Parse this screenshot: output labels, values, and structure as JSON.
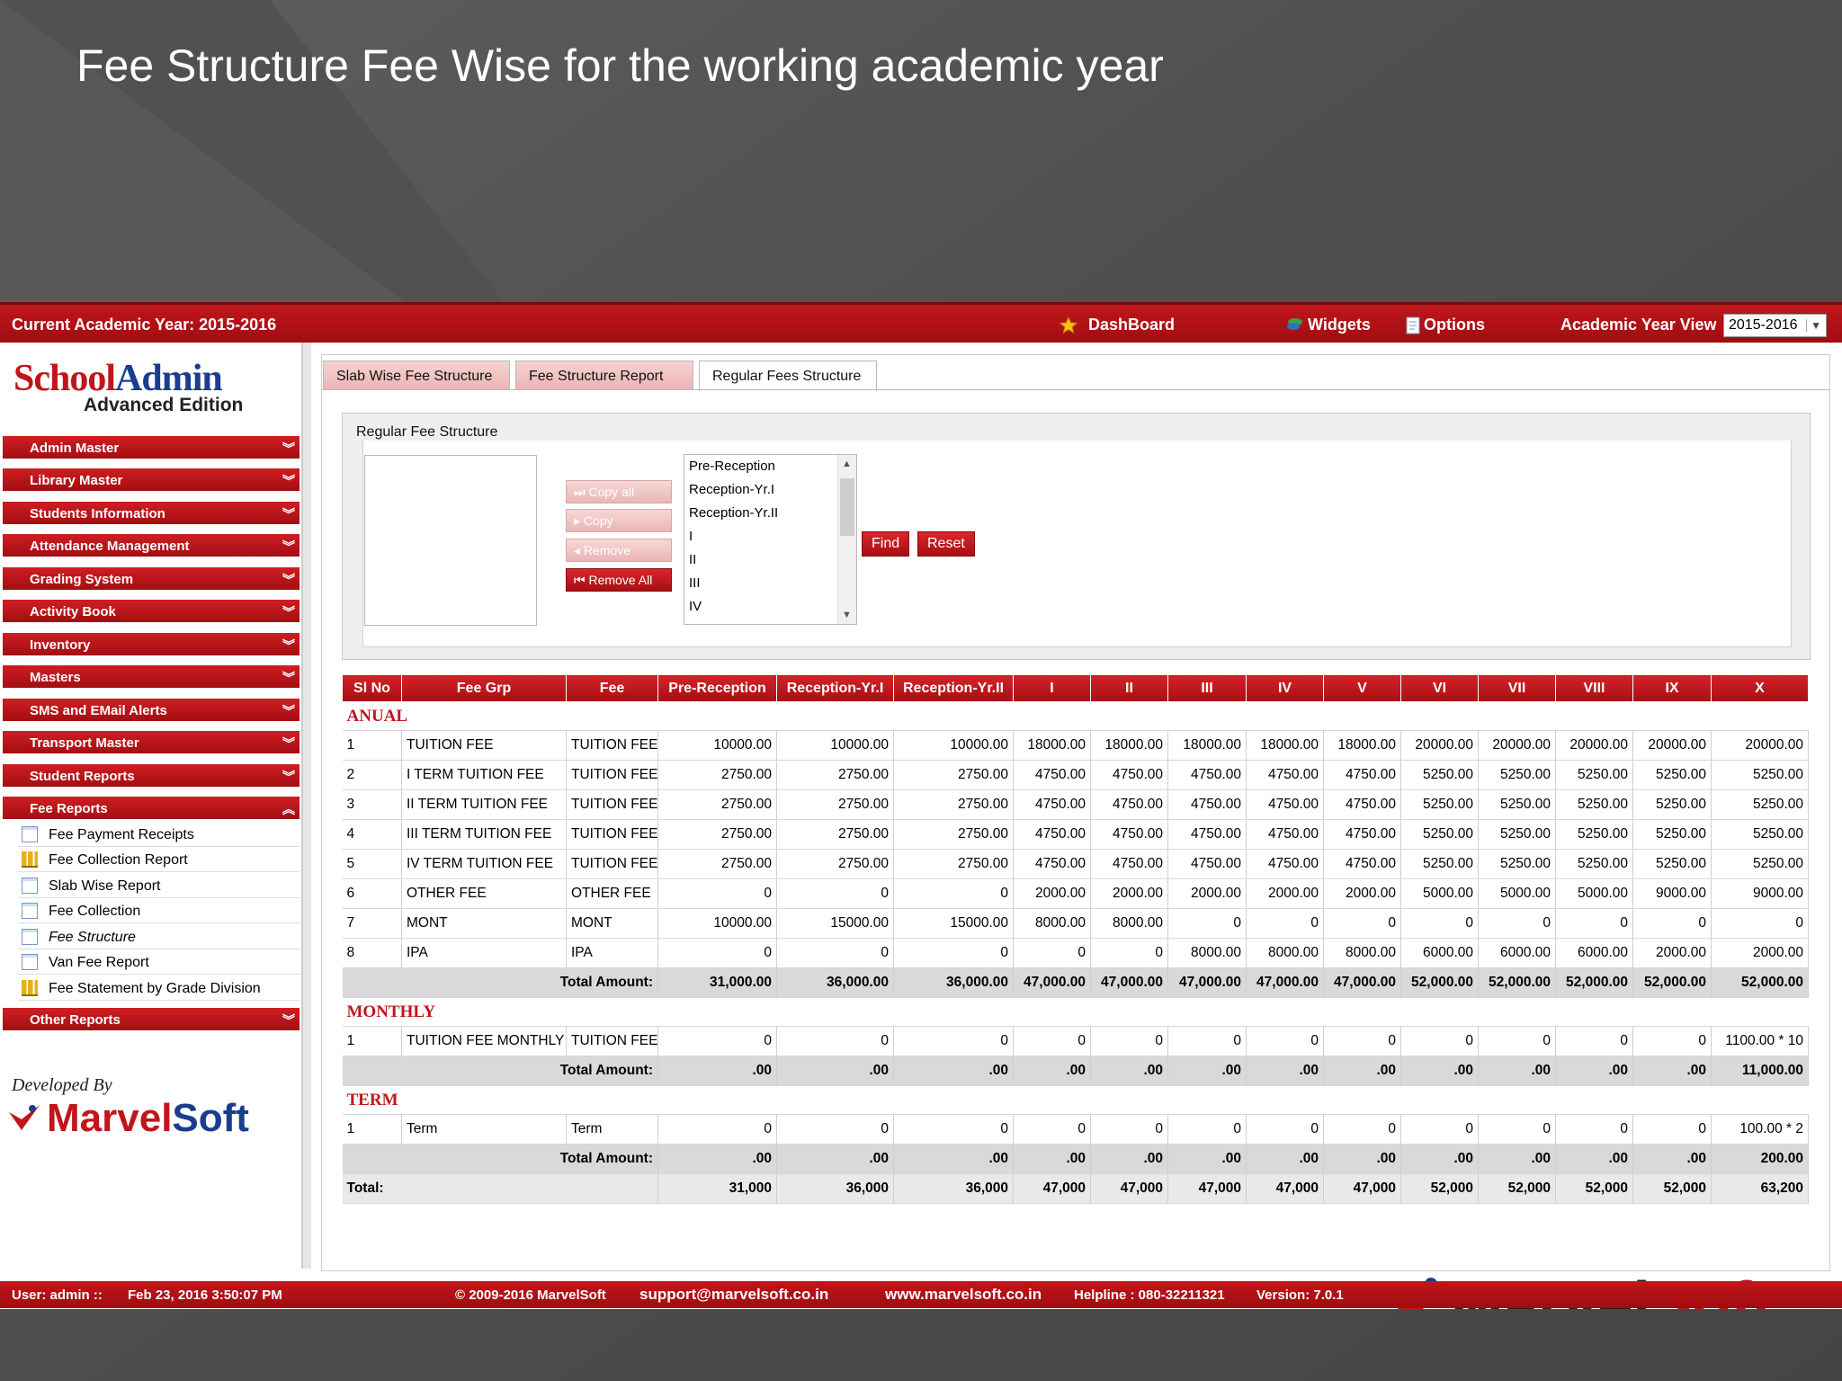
{
  "slide": {
    "title": "Fee Structure Fee Wise for the working academic year"
  },
  "topbar": {
    "academic_year": "Current Academic Year: 2015-2016",
    "dashboard": "DashBoard",
    "widgets": "Widgets",
    "options": "Options",
    "academic_year_view": "Academic Year View",
    "year_select": "2015-2016"
  },
  "logo": {
    "part1": "School",
    "part2": "Admin",
    "edition": "Advanced Edition"
  },
  "sidebar": {
    "menus": [
      "Admin Master",
      "Library Master",
      "Students Information",
      "Attendance Management",
      "Grading System",
      "Activity Book",
      "Inventory",
      "Masters",
      "SMS and EMail Alerts",
      "Transport Master",
      "Student Reports",
      "Fee Reports"
    ],
    "fee_reports_items": [
      "Fee Payment Receipts",
      "Fee Collection Report",
      "Slab Wise Report",
      "Fee Collection",
      "Fee Structure",
      "Van Fee Report",
      "Fee Statement by Grade Division"
    ],
    "other_reports": "Other Reports",
    "developed_by": "Developed By",
    "brand1": "Marvel",
    "brand2": "Soft"
  },
  "tabs": [
    "Slab Wise Fee Structure",
    "Fee Structure Report",
    "Regular Fees Structure"
  ],
  "form": {
    "legend": "Regular Fee Structure",
    "btn_copy_all": "Copy all",
    "btn_copy": "Copy",
    "btn_remove": "Remove",
    "btn_remove_all": "Remove All",
    "class_options": [
      "Pre-Reception",
      "Reception-Yr.I",
      "Reception-Yr.II",
      "I",
      "II",
      "III",
      "IV"
    ],
    "find": "Find",
    "reset": "Reset"
  },
  "grid": {
    "headers": [
      "Sl No",
      "Fee Grp",
      "Fee",
      "Pre-Reception",
      "Reception-Yr.I",
      "Reception-Yr.II",
      "I",
      "II",
      "III",
      "IV",
      "V",
      "VI",
      "VII",
      "VIII",
      "IX",
      "X"
    ],
    "groups": [
      {
        "name": "ANUAL",
        "rows": [
          [
            "1",
            "TUITION FEE",
            "TUITION FEE",
            "10000.00",
            "10000.00",
            "10000.00",
            "18000.00",
            "18000.00",
            "18000.00",
            "18000.00",
            "18000.00",
            "20000.00",
            "20000.00",
            "20000.00",
            "20000.00",
            "20000.00"
          ],
          [
            "2",
            "I TERM TUITION FEE",
            "TUITION FEE",
            "2750.00",
            "2750.00",
            "2750.00",
            "4750.00",
            "4750.00",
            "4750.00",
            "4750.00",
            "4750.00",
            "5250.00",
            "5250.00",
            "5250.00",
            "5250.00",
            "5250.00"
          ],
          [
            "3",
            "II TERM TUITION FEE",
            "TUITION FEE",
            "2750.00",
            "2750.00",
            "2750.00",
            "4750.00",
            "4750.00",
            "4750.00",
            "4750.00",
            "4750.00",
            "5250.00",
            "5250.00",
            "5250.00",
            "5250.00",
            "5250.00"
          ],
          [
            "4",
            "III TERM TUITION FEE",
            "TUITION FEE",
            "2750.00",
            "2750.00",
            "2750.00",
            "4750.00",
            "4750.00",
            "4750.00",
            "4750.00",
            "4750.00",
            "5250.00",
            "5250.00",
            "5250.00",
            "5250.00",
            "5250.00"
          ],
          [
            "5",
            "IV TERM TUITION FEE",
            "TUITION FEE",
            "2750.00",
            "2750.00",
            "2750.00",
            "4750.00",
            "4750.00",
            "4750.00",
            "4750.00",
            "4750.00",
            "5250.00",
            "5250.00",
            "5250.00",
            "5250.00",
            "5250.00"
          ],
          [
            "6",
            "OTHER FEE",
            "OTHER FEE",
            "0",
            "0",
            "0",
            "2000.00",
            "2000.00",
            "2000.00",
            "2000.00",
            "2000.00",
            "5000.00",
            "5000.00",
            "5000.00",
            "9000.00",
            "9000.00"
          ],
          [
            "7",
            "MONT",
            "MONT",
            "10000.00",
            "15000.00",
            "15000.00",
            "8000.00",
            "8000.00",
            "0",
            "0",
            "0",
            "0",
            "0",
            "0",
            "0",
            "0"
          ],
          [
            "8",
            "IPA",
            "IPA",
            "0",
            "0",
            "0",
            "0",
            "0",
            "8000.00",
            "8000.00",
            "8000.00",
            "6000.00",
            "6000.00",
            "6000.00",
            "2000.00",
            "2000.00"
          ]
        ],
        "total_label": "Total Amount:",
        "totals": [
          "31,000.00",
          "36,000.00",
          "36,000.00",
          "47,000.00",
          "47,000.00",
          "47,000.00",
          "47,000.00",
          "47,000.00",
          "52,000.00",
          "52,000.00",
          "52,000.00",
          "52,000.00",
          "52,000.00"
        ]
      },
      {
        "name": "MONTHLY",
        "rows": [
          [
            "1",
            "TUITION FEE MONTHLY",
            "TUITION FEE",
            "0",
            "0",
            "0",
            "0",
            "0",
            "0",
            "0",
            "0",
            "0",
            "0",
            "0",
            "0",
            "1100.00 * 10"
          ]
        ],
        "total_label": "Total Amount:",
        "totals": [
          ".00",
          ".00",
          ".00",
          ".00",
          ".00",
          ".00",
          ".00",
          ".00",
          ".00",
          ".00",
          ".00",
          ".00",
          "11,000.00"
        ]
      },
      {
        "name": "TERM",
        "rows": [
          [
            "1",
            "Term",
            "Term",
            "0",
            "0",
            "0",
            "0",
            "0",
            "0",
            "0",
            "0",
            "0",
            "0",
            "0",
            "0",
            "100.00 * 2"
          ]
        ],
        "total_label": "Total Amount:",
        "totals": [
          ".00",
          ".00",
          ".00",
          ".00",
          ".00",
          ".00",
          ".00",
          ".00",
          ".00",
          ".00",
          ".00",
          ".00",
          "200.00"
        ]
      }
    ],
    "grand_total_label": "Total:",
    "grand_totals": [
      "31,000",
      "36,000",
      "36,000",
      "47,000",
      "47,000",
      "47,000",
      "47,000",
      "47,000",
      "52,000",
      "52,000",
      "52,000",
      "52,000",
      "63,200"
    ]
  },
  "footer": {
    "user": "User: admin ::",
    "datetime": "Feb 23, 2016 3:50:07 PM",
    "copyright": "© 2009-2016 MarvelSoft",
    "email": "support@marvelsoft.co.in",
    "website": "www.marvelsoft.co.in",
    "helpline": "Helpline : 080-32211321",
    "version": "Version: 7.0.1"
  },
  "colors": {
    "brand_red": "#c0161b",
    "brand_blue": "#1b3d8f"
  },
  "icons": [
    "star-icon",
    "widgets-icon",
    "options-icon",
    "chevron-down-icon",
    "chevron-up-icon",
    "document-icon",
    "chart-icon",
    "marvelsoft-logo-icon"
  ]
}
